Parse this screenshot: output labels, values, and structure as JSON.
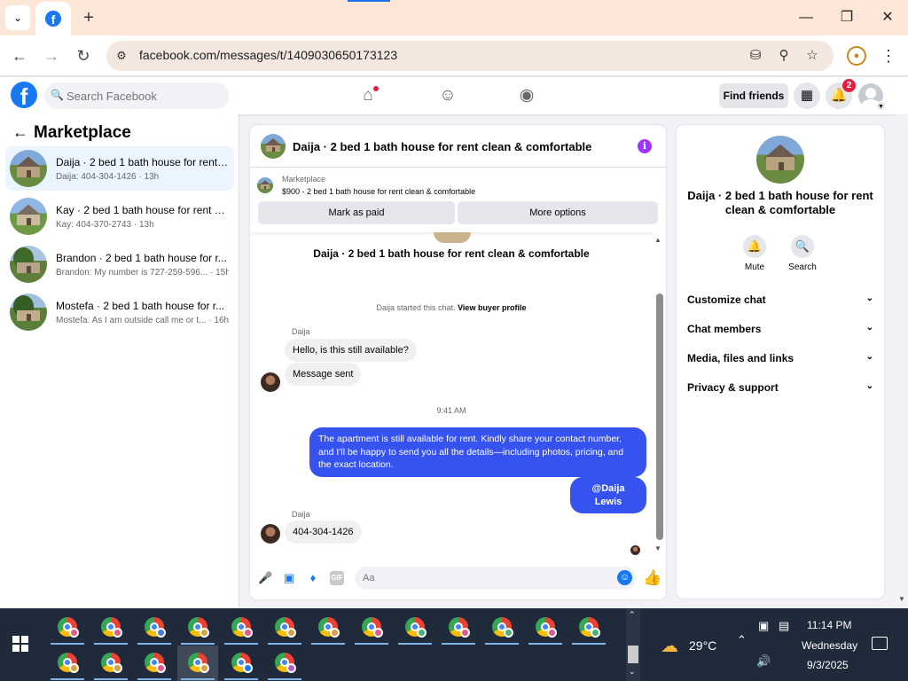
{
  "browser": {
    "url": "facebook.com/messages/t/1409030650173123",
    "icons": [
      "tab-search-icon",
      "facebook-favicon",
      "new-tab-icon",
      "minimize-icon",
      "maximize-icon",
      "close-icon",
      "back-icon",
      "forward-icon",
      "reload-icon",
      "site-info-icon",
      "install-icon",
      "zoom-icon",
      "bookmark-star-icon",
      "profile-icon",
      "menu-icon"
    ]
  },
  "fbnav": {
    "search_placeholder": "Search Facebook",
    "find_friends": "Find friends",
    "notification_count": "2",
    "icons": [
      "home-icon",
      "friends-icon",
      "groups-icon",
      "menu-grid-icon",
      "bell-icon"
    ]
  },
  "left": {
    "title": "Marketplace",
    "conversations": [
      {
        "title": "Daija · 2 bed 1 bath house for rent ...",
        "preview": "Daija: 404-304-1426 · 13h"
      },
      {
        "title": "Kay · 2 bed 1 bath house for rent cl...",
        "preview": "Kay: 404-370-2743 · 13h"
      },
      {
        "title": "Brandon · 2 bed 1 bath house for r...",
        "preview": "Brandon: My number is 727-259-596... · 15h"
      },
      {
        "title": "Mostefa · 2 bed 1 bath house for r...",
        "preview": "Mostefa: As I am outside call me or t... · 16h"
      }
    ]
  },
  "chat": {
    "header_title": "Daija · 2 bed 1 bath house for rent clean & comfortable",
    "marketplace_label": "Marketplace",
    "listing_desc": "$900 - 2 bed 1 bath house for rent clean & comfortable",
    "mark_paid": "Mark as paid",
    "more_options": "More options",
    "listing_title": "Daija · 2 bed 1 bath house for rent clean & comfortable",
    "system_text": "Daija started this chat.",
    "view_profile": "View buyer profile",
    "sender1": "Daija",
    "msg1": "Hello, is this still available?",
    "msg2": "Message sent",
    "time": "9:41 AM",
    "out1": "The apartment is still available for rent. Kindly share your contact number, and I'll be happy to send you all the details—including photos, pricing, and the exact location.",
    "out2": "@Daija Lewis",
    "sender2": "Daija",
    "msg3": "404-304-1426",
    "composer_placeholder": "Aa",
    "composer_icons": [
      "microphone-icon",
      "photo-icon",
      "sticker-icon",
      "gif-icon",
      "emoji-icon",
      "thumbs-up-icon"
    ],
    "gif_label": "GIF"
  },
  "right": {
    "title": "Daija · 2 bed 1 bath house for rent clean & comfortable",
    "mute": "Mute",
    "search": "Search",
    "sections": [
      "Customize chat",
      "Chat members",
      "Media, files and links",
      "Privacy & support"
    ]
  },
  "taskbar": {
    "temperature": "29°C",
    "time": "11:14 PM",
    "day": "Wednesday",
    "date": "9/3/2025"
  }
}
